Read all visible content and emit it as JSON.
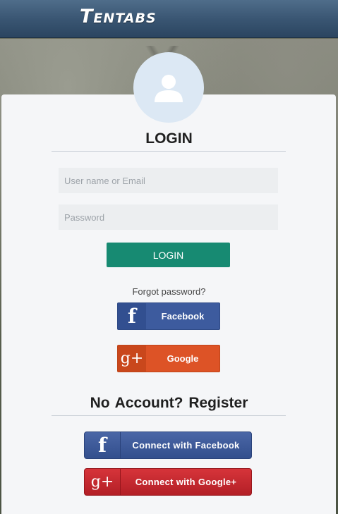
{
  "header": {
    "brand": "Tentabs"
  },
  "login": {
    "title": "LOGIN",
    "username_placeholder": "User name or Email",
    "password_placeholder": "Password",
    "button_label": "LOGIN",
    "forgot_label": "Forgot password?",
    "facebook_label": "Facebook",
    "google_label": "Google"
  },
  "register": {
    "title": "No Account?  Register",
    "facebook_label": "Connect with Facebook",
    "google_label": "Connect with Google+"
  },
  "colors": {
    "header": "#3a5673",
    "login_button": "#178a72",
    "facebook": "#3d5b9e",
    "google": "#dd5326",
    "google_plus": "#c4272e"
  },
  "icons": {
    "avatar": "user-silhouette-icon",
    "facebook": "facebook-f-icon",
    "google": "google-plus-icon"
  }
}
